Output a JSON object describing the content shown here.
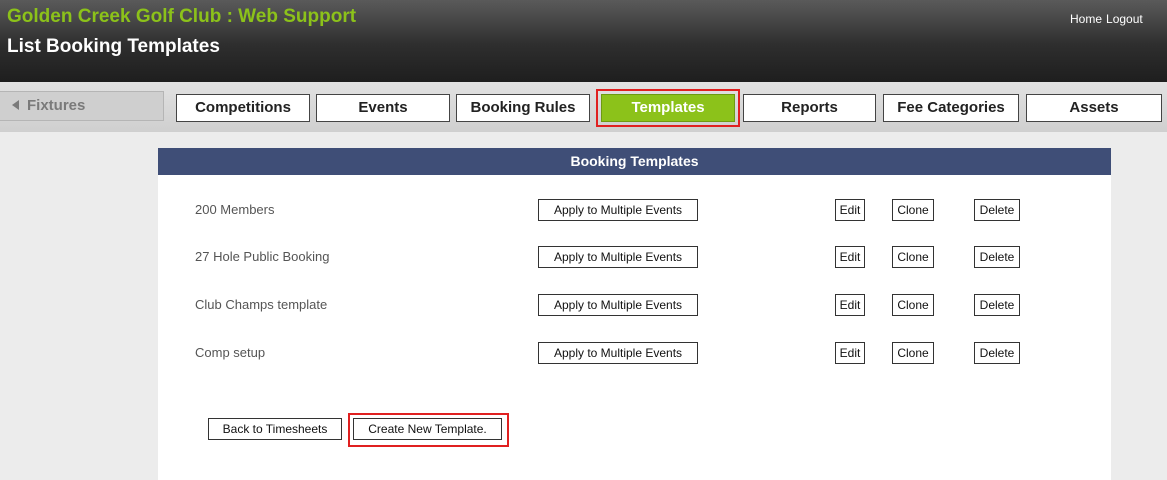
{
  "header": {
    "club_title": "Golden Creek Golf Club : Web Support",
    "page_title": "List Booking Templates",
    "home_link": "Home",
    "logout_link": "Logout"
  },
  "nav": {
    "back_label": "Fixtures",
    "tabs": [
      {
        "label": "Competitions"
      },
      {
        "label": "Events"
      },
      {
        "label": "Booking Rules"
      },
      {
        "label": "Templates",
        "active": true
      },
      {
        "label": "Reports"
      },
      {
        "label": "Fee Categories"
      },
      {
        "label": "Assets"
      }
    ]
  },
  "panel": {
    "title": "Booking Templates",
    "rows": [
      {
        "name": "200 Members",
        "apply_label": "Apply to Multiple Events",
        "edit_label": "Edit",
        "clone_label": "Clone",
        "delete_label": "Delete"
      },
      {
        "name": "27 Hole Public Booking",
        "apply_label": "Apply to Multiple Events",
        "edit_label": "Edit",
        "clone_label": "Clone",
        "delete_label": "Delete"
      },
      {
        "name": "Club Champs template",
        "apply_label": "Apply to Multiple Events",
        "edit_label": "Edit",
        "clone_label": "Clone",
        "delete_label": "Delete"
      },
      {
        "name": "Comp setup",
        "apply_label": "Apply to Multiple Events",
        "edit_label": "Edit",
        "clone_label": "Clone",
        "delete_label": "Delete"
      }
    ],
    "back_button": "Back to Timesheets",
    "create_button": "Create New Template."
  },
  "colors": {
    "brand_green": "#8cc21a",
    "panel_header": "#3f4e77",
    "highlight_red": "#e02020"
  }
}
